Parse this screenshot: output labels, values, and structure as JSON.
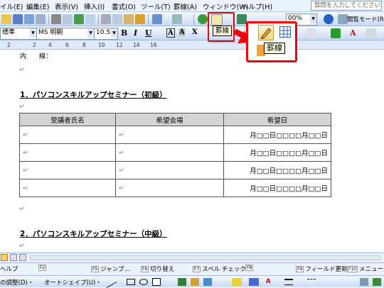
{
  "menubar": {
    "items": [
      "イル(E)",
      "編集(E)",
      "表示(V)",
      "挿入(I)",
      "書式(O)",
      "ツール(T)",
      "罫線(A)",
      "ウィンドウ(W)",
      "ヘルプ(H)"
    ],
    "help_placeholder": "質問を入力してください"
  },
  "toolbar": {
    "zoom": "00%",
    "reading_mode": "閲覧モード(R)"
  },
  "format_bar": {
    "style": "標準",
    "font": "MS 明朝",
    "size": "10.5"
  },
  "ruler": {
    "ticks": [
      "2",
      "2",
      "4",
      "6",
      "8",
      "10",
      "12",
      "14",
      "16"
    ]
  },
  "tooltip_small": "罫線",
  "tooltip_large": "罫線",
  "document": {
    "top_line": "内　　線：",
    "heading1": "1．パソコンスキルアップセミナー（初級）",
    "heading2": "2．パソコンスキルアップセミナー（中級）",
    "table": {
      "headers": [
        "受講者氏名",
        "希望会場",
        "希望日"
      ],
      "date_cell": "月□□日□□□□月□□日",
      "row_count": 4
    },
    "para_mark": "↵"
  },
  "fkeys": {
    "items": [
      {
        "key": "",
        "label": "ヘルプ"
      },
      {
        "key": "F2",
        "label": ""
      },
      {
        "key": "F5",
        "label": "ジャンプ..."
      },
      {
        "key": "F6",
        "label": "切り替え"
      },
      {
        "key": "F7",
        "label": "スペル チェック..."
      },
      {
        "key": "F8",
        "label": ""
      },
      {
        "key": "F9",
        "label": "フィールド更新"
      },
      {
        "key": "F10",
        "label": "メニューバー"
      }
    ]
  },
  "drawbar": {
    "adjust": "の調整(D)・",
    "autoshape": "オートシェイプ(U)・"
  }
}
